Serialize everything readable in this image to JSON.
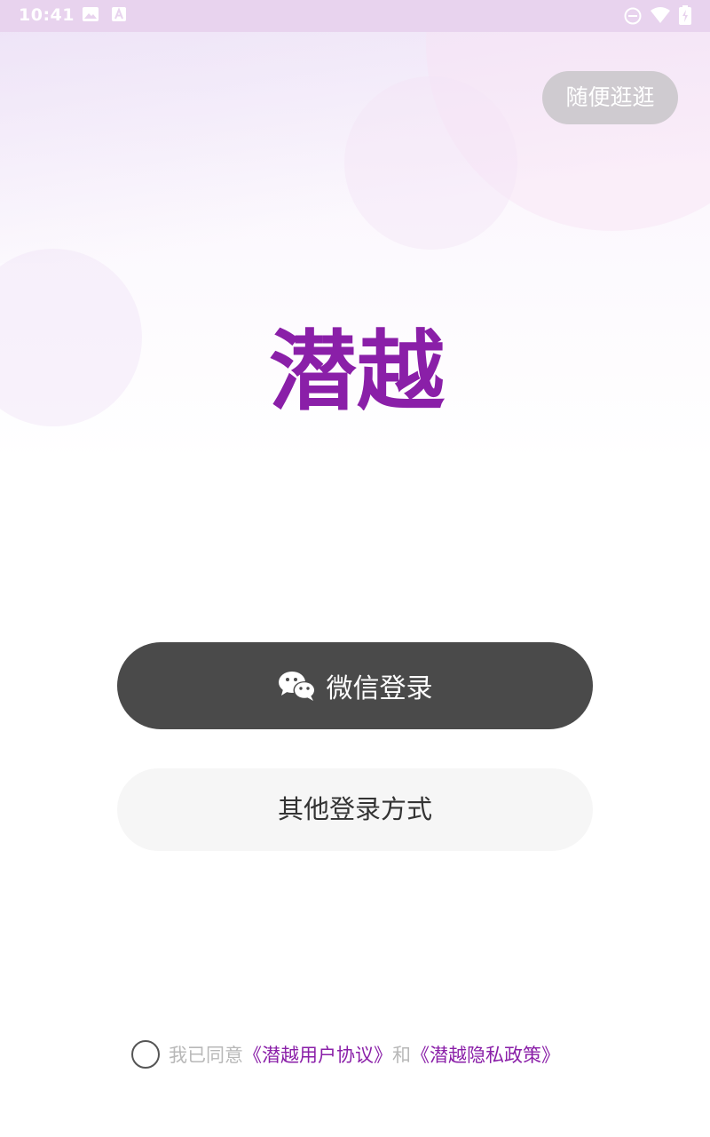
{
  "status_bar": {
    "time": "10:41",
    "icons": [
      "image-icon",
      "a-icon",
      "dnd-icon",
      "wifi-icon",
      "battery-icon"
    ]
  },
  "browse_label": "随便逛逛",
  "brand": {
    "logo_text": "潜越",
    "color": "#8a1fa8"
  },
  "login": {
    "wechat_label": "微信登录",
    "other_label": "其他登录方式"
  },
  "agreement": {
    "checked": false,
    "prefix": "我已同意",
    "user_agreement": "《潜越用户协议》",
    "conjunction": "和",
    "privacy_policy": "《潜越隐私政策》"
  },
  "colors": {
    "accent": "#8a1fa8",
    "wechat_button": "#4a4a4a",
    "other_button": "#f6f6f6",
    "status_bar": "#e8d3ee"
  }
}
